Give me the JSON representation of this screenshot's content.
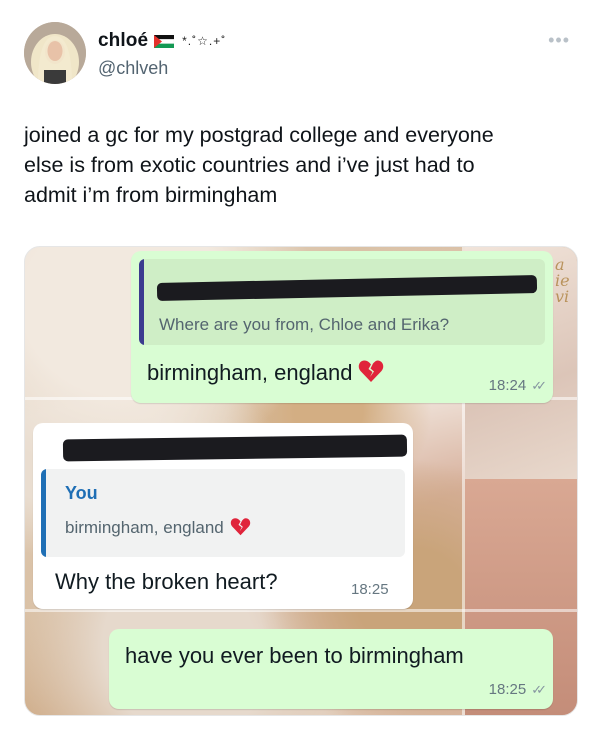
{
  "author": {
    "display_name": "chloé",
    "flag_icon": "palestine-flag-icon",
    "sparkle_decoration": "*.˚☆.+˚",
    "handle": "@chlveh"
  },
  "tweet": {
    "text": "joined a gc for my postgrad college and everyone\nelse is from exotic countries and i’ve just had to\nadmit i’m from birmingham",
    "more_icon": "more-options-icon"
  },
  "chat": {
    "message1": {
      "quote_text": "Where are you from, Chloe and Erika?",
      "text": "birmingham, england",
      "emoji_icon": "broken-heart-icon",
      "time": "18:24"
    },
    "message2": {
      "quote_sender": "You",
      "quote_text": "birmingham, england",
      "emoji_icon": "broken-heart-icon",
      "text": "Why the broken heart?",
      "time": "18:25"
    },
    "message3": {
      "text": "have you ever been to birmingham",
      "time": "18:25"
    }
  },
  "colors": {
    "outgoing_bubble": "#d9fdd3",
    "incoming_bubble": "#ffffff",
    "quote_accent": "#1f6fb5",
    "handle_gray": "#536471"
  }
}
